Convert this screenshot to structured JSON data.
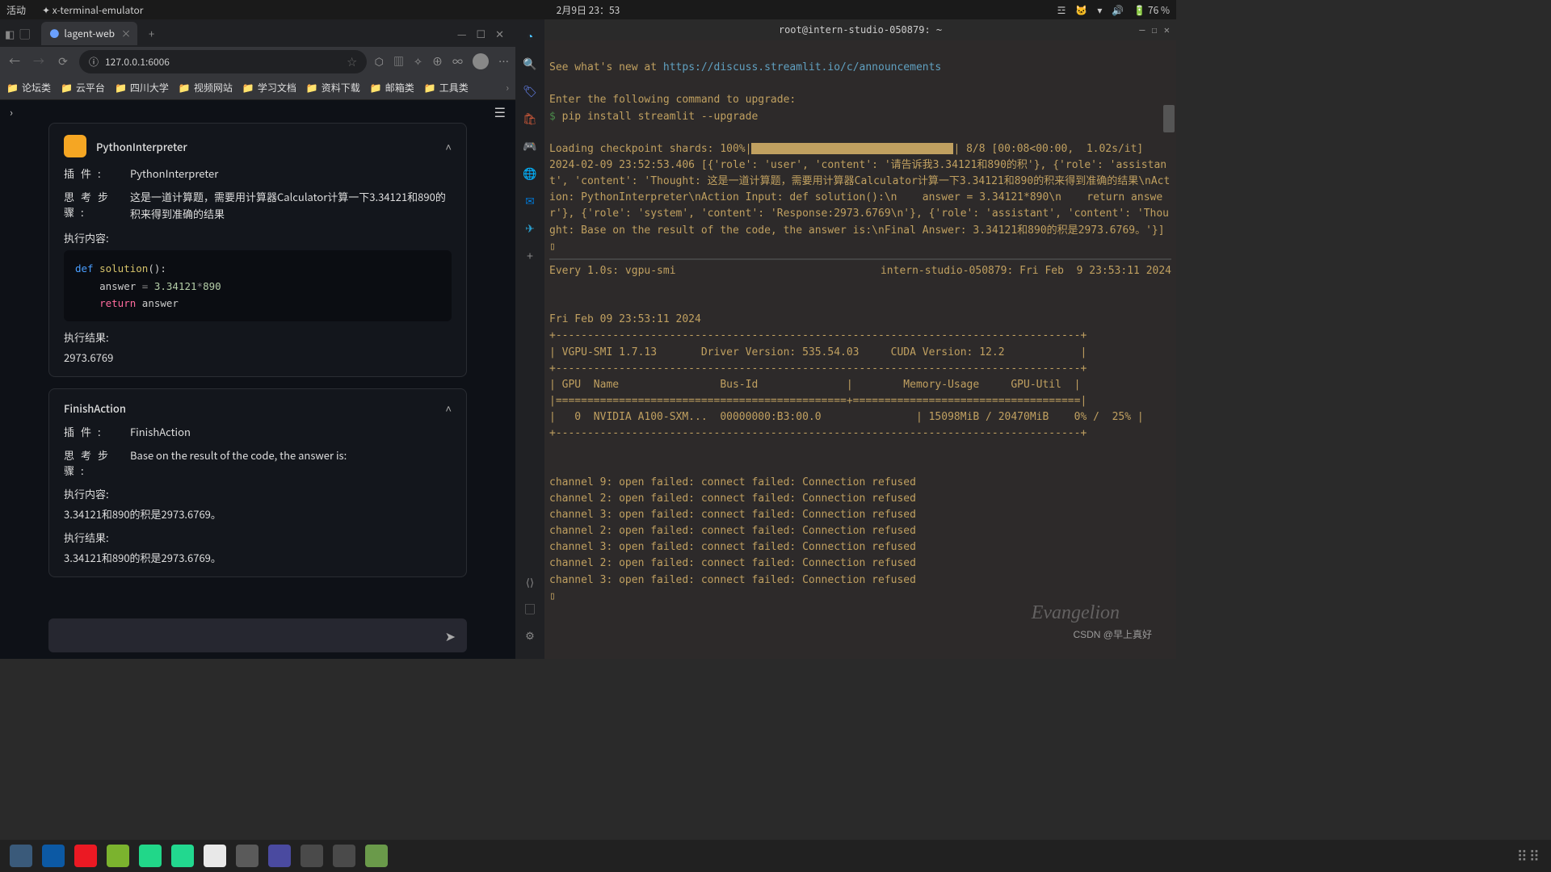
{
  "topbar": {
    "activity": "活动",
    "app": "x-terminal-emulator",
    "datetime": "2月9日 23：53",
    "battery": "76 %"
  },
  "browser": {
    "tab_title": "lagent-web",
    "url": "127.0.0.1:6006",
    "bookmarks": [
      "论坛类",
      "云平台",
      "四川大学",
      "视频网站",
      "学习文档",
      "资料下载",
      "邮箱类",
      "工具类"
    ]
  },
  "chat": {
    "card1": {
      "title": "PythonInterpreter",
      "plugin_k": "插件:",
      "plugin_v": "PythonInterpreter",
      "think_k": "思考步骤:",
      "think_v": "这是一道计算题，需要用计算器Calculator计算一下3.34121和890的积来得到准确的结果",
      "exec_k": "执行内容:",
      "code_def": "def",
      "code_fn": "solution",
      "code_paren": "():",
      "code_l2a": "    answer ",
      "code_eq": "=",
      "code_n1": " 3.34121",
      "code_star": "*",
      "code_n2": "890",
      "code_ret": "    return",
      "code_ans": " answer",
      "result_k": "执行结果:",
      "result_v": "2973.6769"
    },
    "card2": {
      "title": "FinishAction",
      "plugin_k": "插件:",
      "plugin_v": "FinishAction",
      "think_k": "思考步骤:",
      "think_v": "Base on the result of the code, the answer is:",
      "exec_k": "执行内容:",
      "exec_v": "3.34121和890的积是2973.6769。",
      "result_k": "执行结果:",
      "result_v": "3.34121和890的积是2973.6769。"
    }
  },
  "terminal": {
    "title": "root@intern-studio-050879: ~",
    "l1a": "See what's new at ",
    "l1b": "https://discuss.streamlit.io/c/announcements",
    "l3": "Enter the following command to upgrade:",
    "l4": " pip install streamlit --upgrade",
    "l6a": "Loading checkpoint shards: 100%|",
    "l6b": "| 8/8 [00:08<00:00,  1.02s/it]",
    "l7": "2024-02-09 23:52:53.406 [{'role': 'user', 'content': '请告诉我3.34121和890的积'}, {'role': 'assistant', 'content': 'Thought: 这是一道计算题，需要用计算器Calculator计算一下3.34121和890的积来得到准确的结果\\nAction: PythonInterpreter\\nAction Input: def solution():\\n    answer = 3.34121*890\\n    return answer'}, {'role': 'system', 'content': 'Response:2973.6769\\n'}, {'role': 'assistant', 'content': 'Thought: Base on the result of the code, the answer is:\\nFinal Answer: 3.34121和890的积是2973.6769。'}]",
    "w1": "Every 1.0s: vgpu-smi",
    "w1r": "intern-studio-050879: Fri Feb  9 23:53:11 2024",
    "w2": "Fri Feb 09 23:53:11 2024",
    "tbl_top": "+-----------------------------------------------------------------------------------+",
    "tbl_h1": "| VGPU-SMI 1.7.13       Driver Version: 535.54.03     CUDA Version: 12.2            |",
    "tbl_h2": "| GPU  Name                Bus-Id              |        Memory-Usage     GPU-Util  |",
    "tbl_sep": "|==============================================+====================================|",
    "tbl_d1": "|   0  NVIDIA A100-SXM...  00000000:B3:00.0               | 15098MiB / 20470MiB    0% /  25% |",
    "err1": "channel 9: open failed: connect failed: Connection refused",
    "err2": "channel 2: open failed: connect failed: Connection refused",
    "err3": "channel 3: open failed: connect failed: Connection refused",
    "err4": "channel 2: open failed: connect failed: Connection refused",
    "err5": "channel 3: open failed: connect failed: Connection refused",
    "err6": "channel 2: open failed: connect failed: Connection refused",
    "err7": "channel 3: open failed: connect failed: Connection refused"
  },
  "watermark": {
    "sig": "Evangelion",
    "csdn": "CSDN @早上真好"
  }
}
